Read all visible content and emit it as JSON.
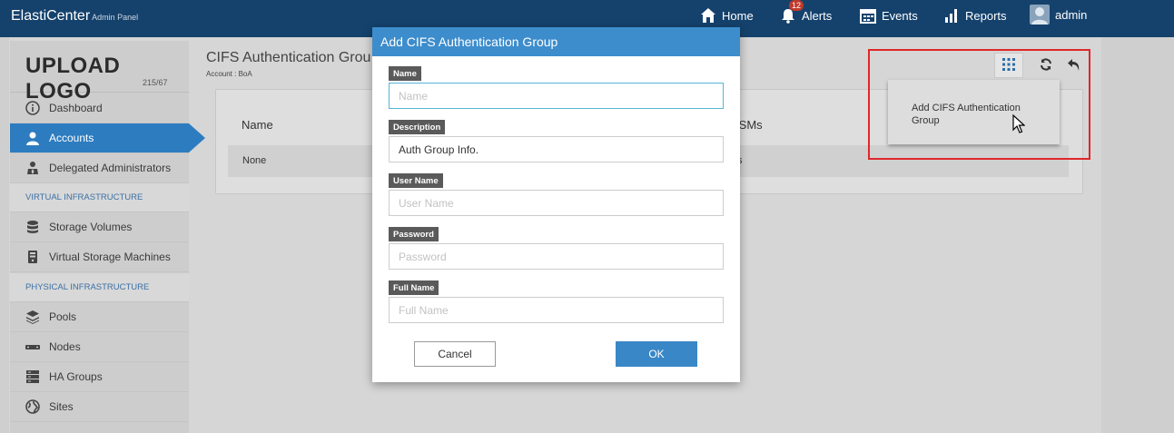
{
  "brand": {
    "name": "ElastiCenter",
    "sub": "Admin Panel"
  },
  "topnav": {
    "home": "Home",
    "alerts": "Alerts",
    "alerts_count": "12",
    "events": "Events",
    "reports": "Reports",
    "user": "admin"
  },
  "sidebar": {
    "logo_text": "UPLOAD LOGO",
    "logo_size": "215/67",
    "items_top": [
      {
        "label": "Dashboard",
        "icon": "info-circle-icon"
      },
      {
        "label": "Accounts",
        "icon": "user-icon"
      },
      {
        "label": "Delegated Administrators",
        "icon": "users-icon"
      }
    ],
    "section_virtual": "VIRTUAL INFRASTRUCTURE",
    "items_virtual": [
      {
        "label": "Storage Volumes",
        "icon": "database-icon"
      },
      {
        "label": "Virtual Storage Machines",
        "icon": "server-icon"
      }
    ],
    "section_physical": "PHYSICAL INFRASTRUCTURE",
    "items_physical": [
      {
        "label": "Pools",
        "icon": "layers-icon"
      },
      {
        "label": "Nodes",
        "icon": "node-icon"
      },
      {
        "label": "HA Groups",
        "icon": "stack-icon"
      },
      {
        "label": "Sites",
        "icon": "globe-icon"
      }
    ]
  },
  "main": {
    "title": "CIFS Authentication Grou",
    "subtitle": "Account : BoA",
    "table": {
      "columns": [
        "Name",
        "VSMs"
      ],
      "rows": [
        [
          "None",
          "s"
        ]
      ]
    }
  },
  "toolbar": {
    "dropdown_item": "Add CIFS Authentication Group"
  },
  "modal": {
    "title": "Add CIFS Authentication Group",
    "fields": {
      "name": {
        "label": "Name",
        "placeholder": "Name",
        "value": ""
      },
      "description": {
        "label": "Description",
        "placeholder": "Description",
        "value": "Auth Group Info."
      },
      "username": {
        "label": "User Name",
        "placeholder": "User Name",
        "value": ""
      },
      "password": {
        "label": "Password",
        "placeholder": "Password",
        "value": ""
      },
      "fullname": {
        "label": "Full Name",
        "placeholder": "Full Name",
        "value": ""
      }
    },
    "cancel_label": "Cancel",
    "ok_label": "OK"
  },
  "colors": {
    "topbar": "#14426c",
    "accent": "#3d8ccb",
    "active_nav": "#2e7cc0",
    "highlight": "#e0252b"
  }
}
